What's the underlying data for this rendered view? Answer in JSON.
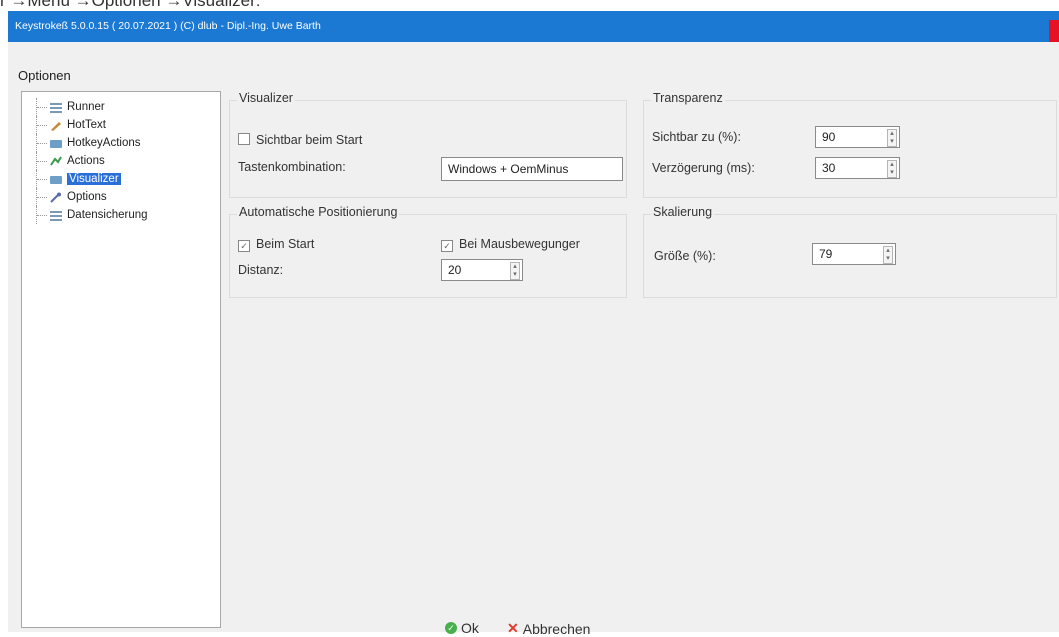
{
  "caption": "r →Menü →Optionen →Visualizer:",
  "window": {
    "title": "Keystrokeß 5.0.0.15  ( 20.07.2021 ) (C)  dlub - Dipl.-Ing. Uwe Barth",
    "options_label": "Optionen"
  },
  "tree": {
    "items": [
      {
        "label": "Runner",
        "icon": "list-icon",
        "color": "#7a9ab8"
      },
      {
        "label": "HotText",
        "icon": "pen-icon",
        "color": "#c48a3a"
      },
      {
        "label": "HotkeyActions",
        "icon": "keyboard-icon",
        "color": "#6ea0c7"
      },
      {
        "label": "Actions",
        "icon": "actions-icon",
        "color": "#3a9a4a"
      },
      {
        "label": "Visualizer",
        "icon": "visualizer-icon",
        "color": "#6ea0c7",
        "selected": true
      },
      {
        "label": "Options",
        "icon": "wrench-icon",
        "color": "#5a6aa8"
      },
      {
        "label": "Datensicherung",
        "icon": "list-icon",
        "color": "#7a9ab8"
      }
    ]
  },
  "visualizer": {
    "group_title": "Visualizer",
    "show_on_start_label": "Sichtbar beim Start",
    "key_combo_label": "Tastenkombination:",
    "key_combo_value": "Windows + OemMinus"
  },
  "positioning": {
    "group_title": "Automatische Positionierung",
    "on_start_label": "Beim Start",
    "on_mouse_label": "Bei Mausbewegunger",
    "distance_label": "Distanz:",
    "distance_value": "20"
  },
  "transparency": {
    "group_title": "Transparenz",
    "visible_label": "Sichtbar zu (%):",
    "visible_value": "90",
    "delay_label": "Verzögerung (ms):",
    "delay_value": "30"
  },
  "scaling": {
    "group_title": "Skalierung",
    "size_label": "Größe (%):",
    "size_value": "79"
  },
  "buttons": {
    "ok_label": "Ok",
    "cancel_label": "Abbrechen"
  }
}
